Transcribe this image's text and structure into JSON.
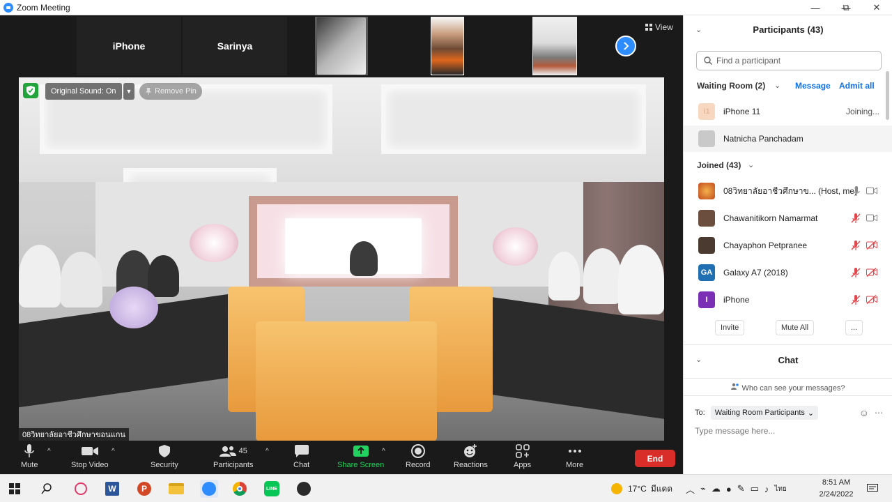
{
  "window": {
    "title": "Zoom Meeting",
    "minimize": "—",
    "maximize": "⧉",
    "close": "✕"
  },
  "strip": {
    "tiles": [
      {
        "name": "iPhone"
      },
      {
        "name": "Sarinya"
      }
    ],
    "view_label": "View"
  },
  "main_video": {
    "original_sound": "Original Sound: On",
    "remove_pin": "Remove Pin",
    "speaker_name": "08วิทยาลัยอาชีวศึกษาขอนแกน"
  },
  "toolbar": {
    "mute": "Mute",
    "stop_video": "Stop Video",
    "security": "Security",
    "participants": "Participants",
    "participants_count": "45",
    "chat": "Chat",
    "share_screen": "Share Screen",
    "record": "Record",
    "reactions": "Reactions",
    "apps": "Apps",
    "more": "More",
    "end": "End"
  },
  "panel": {
    "title": "Participants (43)",
    "search_placeholder": "Find a participant",
    "waiting_room": {
      "label": "Waiting Room (2)",
      "message": "Message",
      "admit_all": "Admit all",
      "items": [
        {
          "name": "iPhone 11",
          "status": "Joining...",
          "initials": "i1",
          "color": "#f8d7c0"
        },
        {
          "name": "Natnicha Panchadam",
          "status": "",
          "initials": "",
          "color": "#c9c9c9"
        }
      ]
    },
    "joined": {
      "label": "Joined (43)",
      "items": [
        {
          "name": "08วิทยาลัยอาชีวศึกษาข... (Host, me)",
          "initials": "",
          "color": "#c2491d",
          "muted": false,
          "video_off": false
        },
        {
          "name": "Chawanitikorn Namarmat",
          "initials": "",
          "color": "#6b4e3d",
          "muted": true,
          "video_off": false
        },
        {
          "name": "Chayaphon Petpranee",
          "initials": "",
          "color": "#4b3a2f",
          "muted": true,
          "video_off": true
        },
        {
          "name": "Galaxy A7 (2018)",
          "initials": "GA",
          "color": "#1f6fb2",
          "muted": true,
          "video_off": true
        },
        {
          "name": "iPhone",
          "initials": "I",
          "color": "#7b2fb5",
          "muted": true,
          "video_off": true
        }
      ]
    },
    "buttons": {
      "invite": "Invite",
      "mute_all": "Mute All",
      "more": "..."
    },
    "chat": {
      "title": "Chat",
      "who_can_see": "Who can see your messages?",
      "to_label": "To:",
      "to_value": "Waiting Room Participants",
      "placeholder": "Type message here..."
    }
  },
  "taskbar": {
    "weather": "17°C",
    "weather_text": "มีแดด",
    "lang": "ไทย",
    "time": "8:51 AM",
    "date": "2/24/2022"
  }
}
